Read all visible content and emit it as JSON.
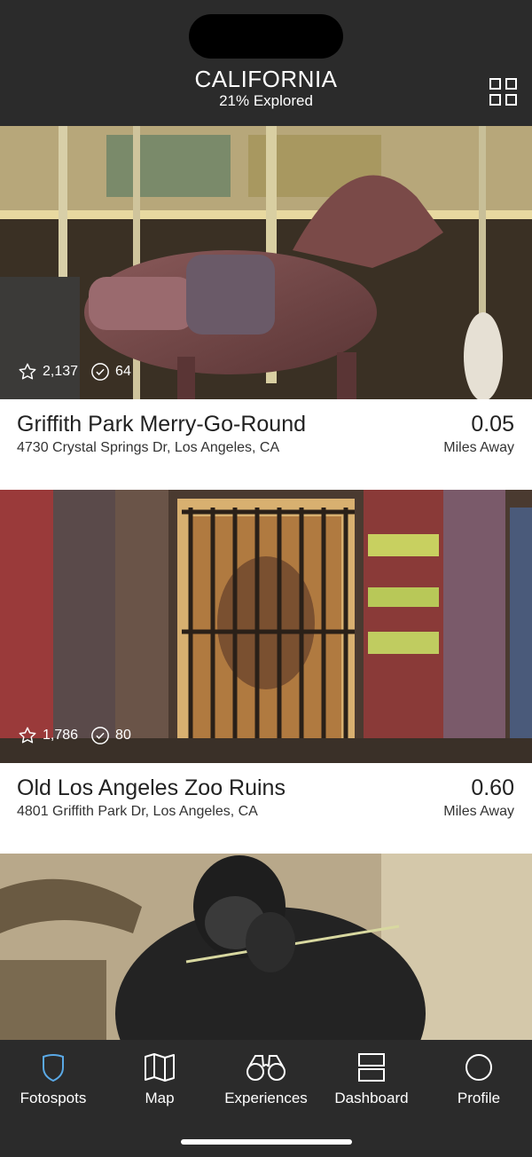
{
  "header": {
    "title": "CALIFORNIA",
    "subtitle": "21% Explored",
    "grid_icon": "grid-view-icon"
  },
  "spots": [
    {
      "name": "Griffith Park Merry-Go-Round",
      "address": "4730 Crystal Springs Dr, Los Angeles, CA",
      "distance": "0.05",
      "distance_unit": "Miles Away",
      "favorites": "2,137",
      "checkins": "64"
    },
    {
      "name": "Old Los Angeles Zoo Ruins",
      "address": "4801 Griffith Park Dr, Los Angeles, CA",
      "distance": "0.60",
      "distance_unit": "Miles Away",
      "favorites": "1,786",
      "checkins": "80"
    }
  ],
  "tabs": [
    {
      "label": "Fotospots",
      "icon": "shield-icon",
      "active": true
    },
    {
      "label": "Map",
      "icon": "map-icon",
      "active": false
    },
    {
      "label": "Experiences",
      "icon": "binoculars-icon",
      "active": false
    },
    {
      "label": "Dashboard",
      "icon": "dashboard-icon",
      "active": false
    },
    {
      "label": "Profile",
      "icon": "profile-circle-icon",
      "active": false
    }
  ],
  "colors": {
    "bar_background": "#2b2b2b",
    "active_tab": "#5aa9e6"
  }
}
